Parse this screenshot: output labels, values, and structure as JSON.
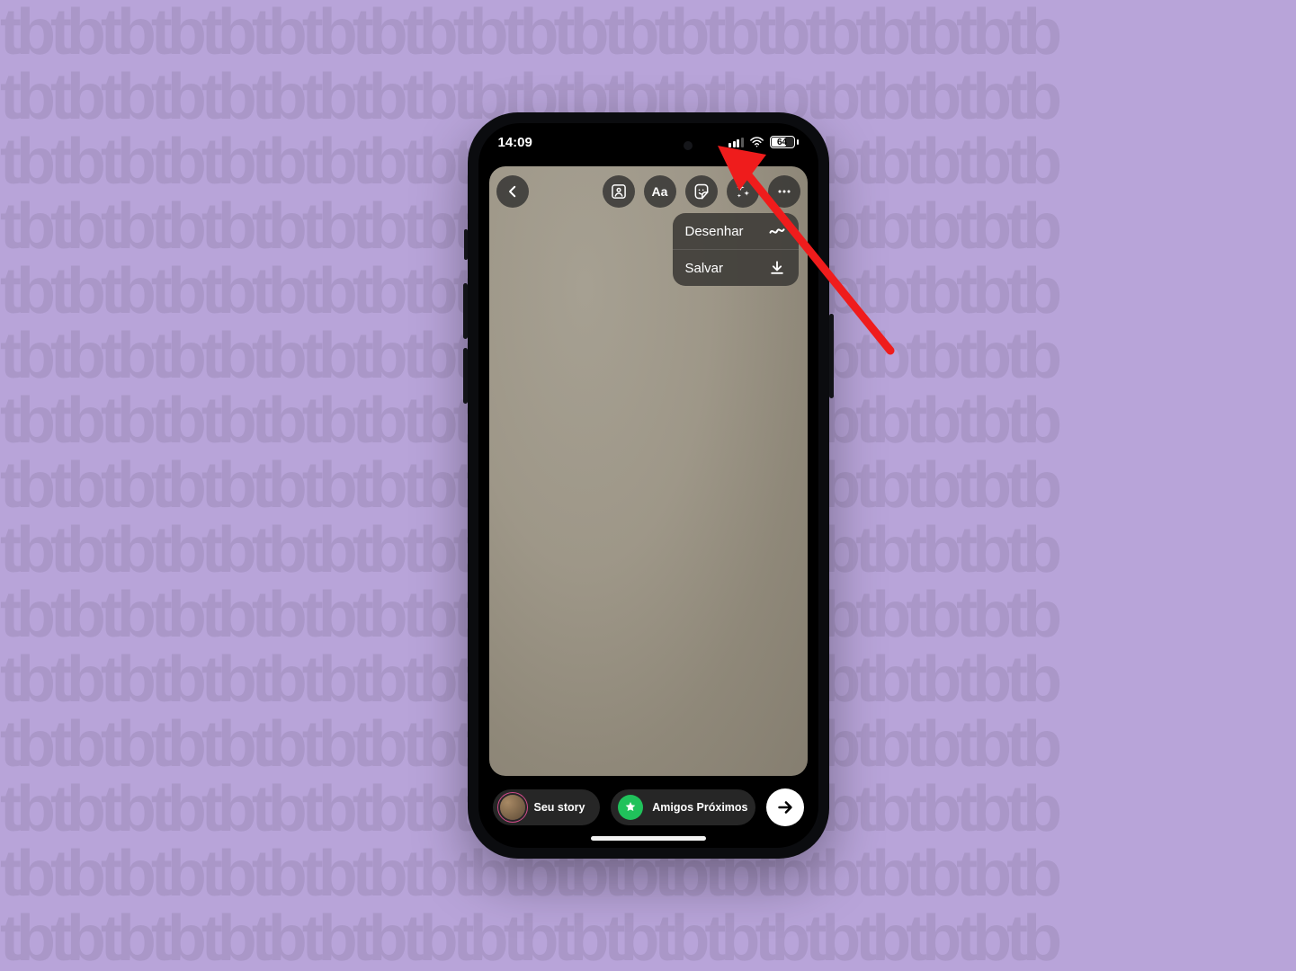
{
  "status": {
    "time": "14:09",
    "battery_pct": "64"
  },
  "dropdown": {
    "draw": "Desenhar",
    "save": "Salvar"
  },
  "bottom": {
    "your_story": "Seu story",
    "close_friends": "Amigos Próximos"
  }
}
